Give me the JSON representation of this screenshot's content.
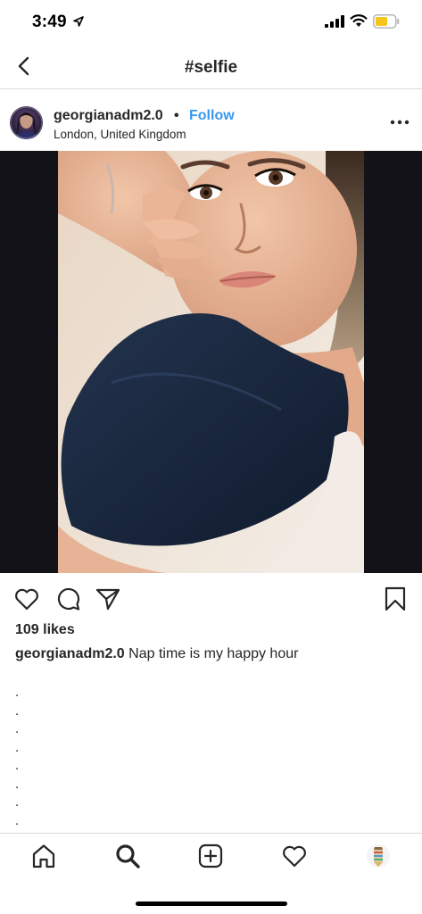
{
  "status_bar": {
    "time": "3:49",
    "icons": [
      "location-arrow-icon",
      "cellular-signal-icon",
      "wifi-icon",
      "battery-icon"
    ],
    "battery_color": "#f5c518"
  },
  "nav": {
    "title": "#selfie",
    "back_icon": "chevron-left-icon"
  },
  "post": {
    "username": "georgianadm2.0",
    "separator": "•",
    "follow_label": "Follow",
    "location": "London, United Kingdom",
    "more_icon": "more-dots-icon",
    "likes_text": "109 likes",
    "caption_user": "georgianadm2.0",
    "caption_text": " Nap time is my happy hour",
    "caption_dots": [
      ".",
      ".",
      ".",
      ".",
      ".",
      ".",
      ".",
      "."
    ],
    "action_icons": [
      "heart-icon",
      "comment-icon",
      "share-icon",
      "bookmark-icon"
    ]
  },
  "tab_bar": {
    "icons": [
      "home-icon",
      "search-icon",
      "add-post-icon",
      "activity-heart-icon",
      "profile-avatar"
    ]
  },
  "colors": {
    "accent": "#3897f0",
    "text": "#262626",
    "divider": "#dbdbdb"
  }
}
